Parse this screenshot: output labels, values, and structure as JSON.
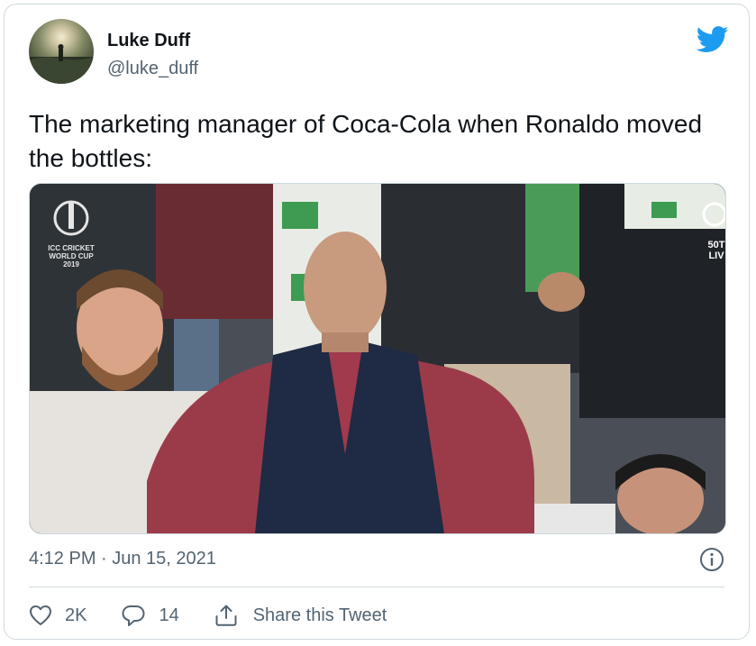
{
  "tweet": {
    "author_name": "Luke Duff",
    "author_handle": "@luke_duff",
    "text": "The marketing manager of Coca-Cola when Ronaldo moved the bottles:",
    "timestamp": "4:12 PM · Jun 15, 2021",
    "media": {
      "overlay_logo_text": [
        "ICC CRICKET",
        "WORLD CUP",
        "2019"
      ],
      "overlay_score_text": [
        "50T",
        "LIV"
      ]
    }
  },
  "actions": {
    "like_count": "2K",
    "reply_count": "14",
    "share_label": "Share this Tweet"
  },
  "icons": {
    "brand": "twitter-bird-icon",
    "info": "info-icon",
    "like": "heart-icon",
    "reply": "comment-icon",
    "share": "share-icon"
  },
  "colors": {
    "twitter_blue": "#1d9bf0",
    "secondary_text": "#536471",
    "primary_text": "#0f1419",
    "border": "#cfd9de"
  }
}
